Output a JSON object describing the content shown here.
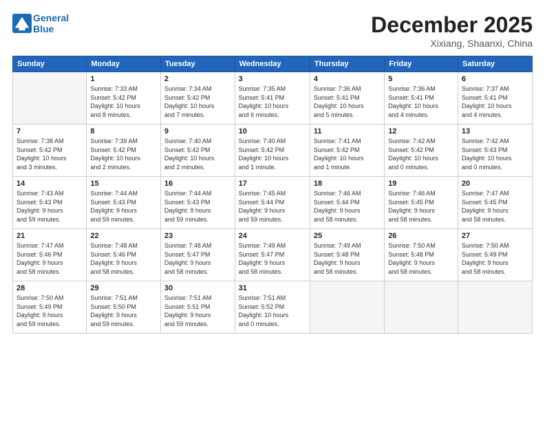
{
  "header": {
    "logo_line1": "General",
    "logo_line2": "Blue",
    "month_title": "December 2025",
    "location": "Xixiang, Shaanxi, China"
  },
  "weekdays": [
    "Sunday",
    "Monday",
    "Tuesday",
    "Wednesday",
    "Thursday",
    "Friday",
    "Saturday"
  ],
  "weeks": [
    [
      {
        "day": "",
        "info": ""
      },
      {
        "day": "1",
        "info": "Sunrise: 7:33 AM\nSunset: 5:42 PM\nDaylight: 10 hours\nand 8 minutes."
      },
      {
        "day": "2",
        "info": "Sunrise: 7:34 AM\nSunset: 5:42 PM\nDaylight: 10 hours\nand 7 minutes."
      },
      {
        "day": "3",
        "info": "Sunrise: 7:35 AM\nSunset: 5:41 PM\nDaylight: 10 hours\nand 6 minutes."
      },
      {
        "day": "4",
        "info": "Sunrise: 7:36 AM\nSunset: 5:41 PM\nDaylight: 10 hours\nand 5 minutes."
      },
      {
        "day": "5",
        "info": "Sunrise: 7:36 AM\nSunset: 5:41 PM\nDaylight: 10 hours\nand 4 minutes."
      },
      {
        "day": "6",
        "info": "Sunrise: 7:37 AM\nSunset: 5:41 PM\nDaylight: 10 hours\nand 4 minutes."
      }
    ],
    [
      {
        "day": "7",
        "info": "Sunrise: 7:38 AM\nSunset: 5:42 PM\nDaylight: 10 hours\nand 3 minutes."
      },
      {
        "day": "8",
        "info": "Sunrise: 7:39 AM\nSunset: 5:42 PM\nDaylight: 10 hours\nand 2 minutes."
      },
      {
        "day": "9",
        "info": "Sunrise: 7:40 AM\nSunset: 5:42 PM\nDaylight: 10 hours\nand 2 minutes."
      },
      {
        "day": "10",
        "info": "Sunrise: 7:40 AM\nSunset: 5:42 PM\nDaylight: 10 hours\nand 1 minute."
      },
      {
        "day": "11",
        "info": "Sunrise: 7:41 AM\nSunset: 5:42 PM\nDaylight: 10 hours\nand 1 minute."
      },
      {
        "day": "12",
        "info": "Sunrise: 7:42 AM\nSunset: 5:42 PM\nDaylight: 10 hours\nand 0 minutes."
      },
      {
        "day": "13",
        "info": "Sunrise: 7:42 AM\nSunset: 5:43 PM\nDaylight: 10 hours\nand 0 minutes."
      }
    ],
    [
      {
        "day": "14",
        "info": "Sunrise: 7:43 AM\nSunset: 5:43 PM\nDaylight: 9 hours\nand 59 minutes."
      },
      {
        "day": "15",
        "info": "Sunrise: 7:44 AM\nSunset: 5:43 PM\nDaylight: 9 hours\nand 59 minutes."
      },
      {
        "day": "16",
        "info": "Sunrise: 7:44 AM\nSunset: 5:43 PM\nDaylight: 9 hours\nand 59 minutes."
      },
      {
        "day": "17",
        "info": "Sunrise: 7:45 AM\nSunset: 5:44 PM\nDaylight: 9 hours\nand 59 minutes."
      },
      {
        "day": "18",
        "info": "Sunrise: 7:46 AM\nSunset: 5:44 PM\nDaylight: 9 hours\nand 58 minutes."
      },
      {
        "day": "19",
        "info": "Sunrise: 7:46 AM\nSunset: 5:45 PM\nDaylight: 9 hours\nand 58 minutes."
      },
      {
        "day": "20",
        "info": "Sunrise: 7:47 AM\nSunset: 5:45 PM\nDaylight: 9 hours\nand 58 minutes."
      }
    ],
    [
      {
        "day": "21",
        "info": "Sunrise: 7:47 AM\nSunset: 5:46 PM\nDaylight: 9 hours\nand 58 minutes."
      },
      {
        "day": "22",
        "info": "Sunrise: 7:48 AM\nSunset: 5:46 PM\nDaylight: 9 hours\nand 58 minutes."
      },
      {
        "day": "23",
        "info": "Sunrise: 7:48 AM\nSunset: 5:47 PM\nDaylight: 9 hours\nand 58 minutes."
      },
      {
        "day": "24",
        "info": "Sunrise: 7:49 AM\nSunset: 5:47 PM\nDaylight: 9 hours\nand 58 minutes."
      },
      {
        "day": "25",
        "info": "Sunrise: 7:49 AM\nSunset: 5:48 PM\nDaylight: 9 hours\nand 58 minutes."
      },
      {
        "day": "26",
        "info": "Sunrise: 7:50 AM\nSunset: 5:48 PM\nDaylight: 9 hours\nand 58 minutes."
      },
      {
        "day": "27",
        "info": "Sunrise: 7:50 AM\nSunset: 5:49 PM\nDaylight: 9 hours\nand 58 minutes."
      }
    ],
    [
      {
        "day": "28",
        "info": "Sunrise: 7:50 AM\nSunset: 5:49 PM\nDaylight: 9 hours\nand 59 minutes."
      },
      {
        "day": "29",
        "info": "Sunrise: 7:51 AM\nSunset: 5:50 PM\nDaylight: 9 hours\nand 59 minutes."
      },
      {
        "day": "30",
        "info": "Sunrise: 7:51 AM\nSunset: 5:51 PM\nDaylight: 9 hours\nand 59 minutes."
      },
      {
        "day": "31",
        "info": "Sunrise: 7:51 AM\nSunset: 5:52 PM\nDaylight: 10 hours\nand 0 minutes."
      },
      {
        "day": "",
        "info": ""
      },
      {
        "day": "",
        "info": ""
      },
      {
        "day": "",
        "info": ""
      }
    ]
  ]
}
